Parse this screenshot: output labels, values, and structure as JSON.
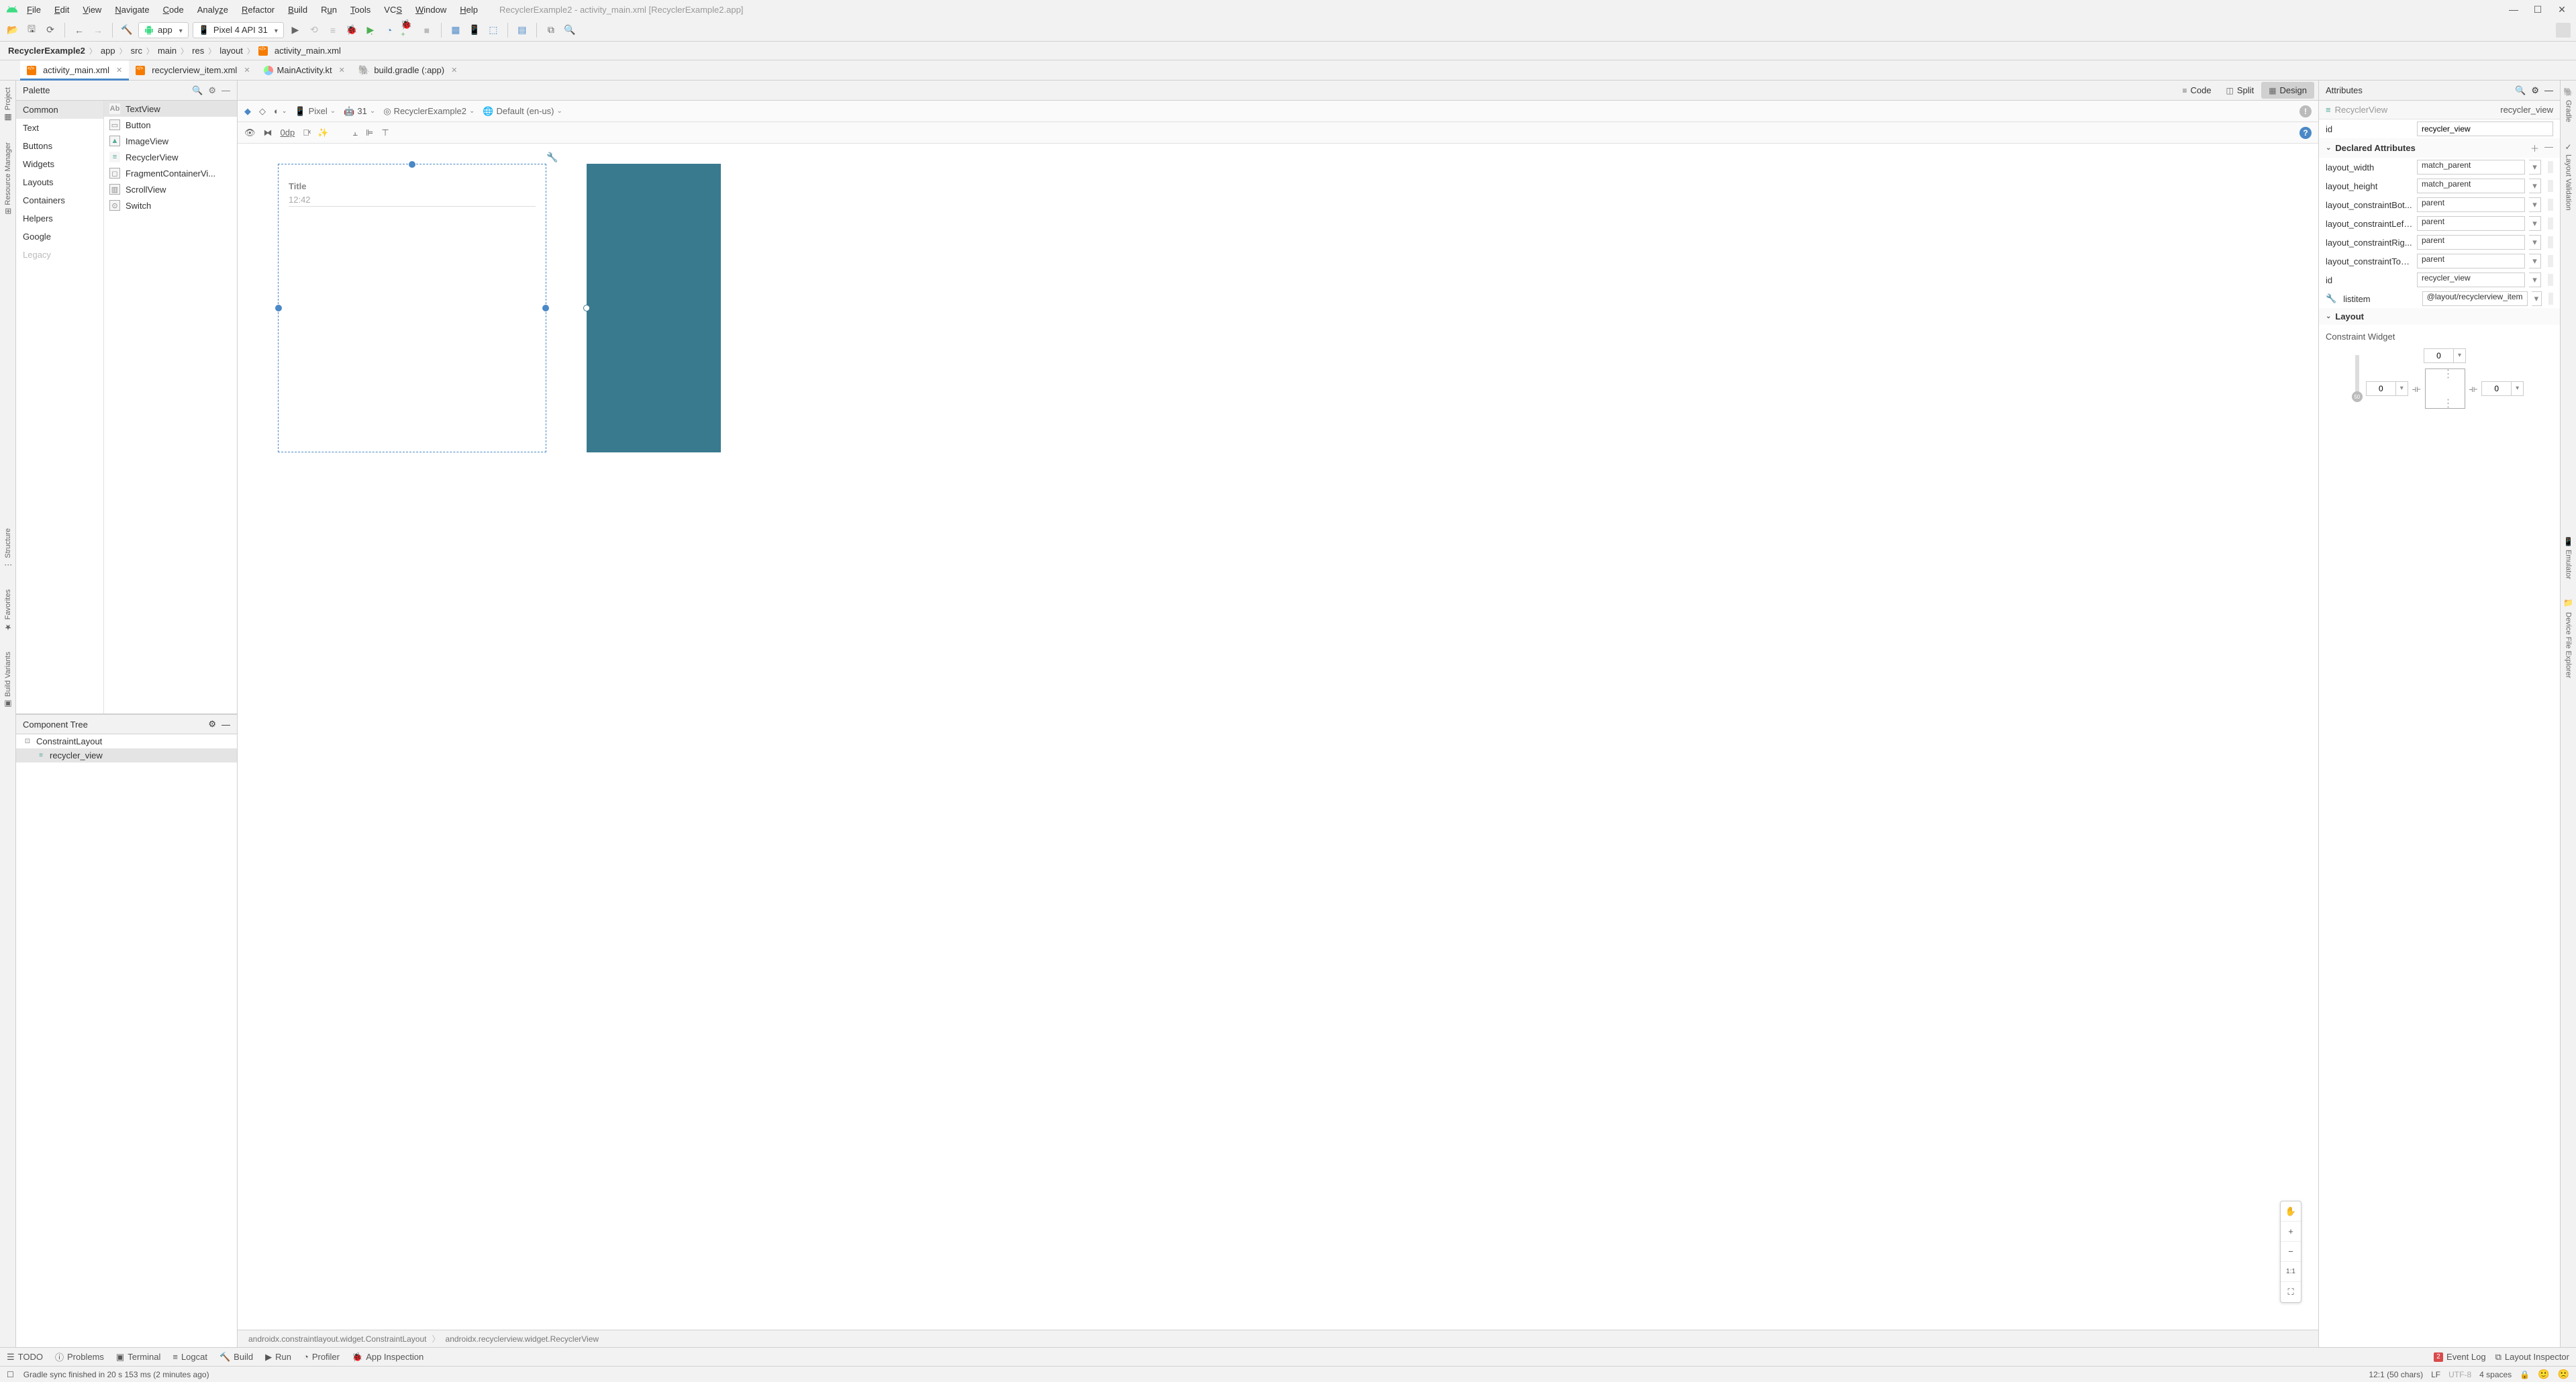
{
  "window": {
    "title_suffix": "RecyclerExample2 - activity_main.xml [RecyclerExample2.app]"
  },
  "menu": [
    "File",
    "Edit",
    "View",
    "Navigate",
    "Code",
    "Analyze",
    "Refactor",
    "Build",
    "Run",
    "Tools",
    "VCS",
    "Window",
    "Help"
  ],
  "toolbar": {
    "run_config": "app",
    "device": "Pixel 4 API 31"
  },
  "breadcrumbs": [
    "RecyclerExample2",
    "app",
    "src",
    "main",
    "res",
    "layout",
    "activity_main.xml"
  ],
  "tabs": [
    {
      "label": "activity_main.xml",
      "icon": "xml",
      "active": true
    },
    {
      "label": "recyclerview_item.xml",
      "icon": "xml",
      "active": false
    },
    {
      "label": "MainActivity.kt",
      "icon": "kt",
      "active": false
    },
    {
      "label": "build.gradle (:app)",
      "icon": "gradle",
      "active": false
    }
  ],
  "view_modes": {
    "code": "Code",
    "split": "Split",
    "design": "Design"
  },
  "left_rail": [
    "Project",
    "Resource Manager",
    "Structure",
    "Favorites",
    "Build Variants"
  ],
  "right_rail": [
    "Gradle",
    "Layout Validation",
    "Emulator",
    "Device File Explorer"
  ],
  "palette": {
    "title": "Palette",
    "categories": [
      "Common",
      "Text",
      "Buttons",
      "Widgets",
      "Layouts",
      "Containers",
      "Helpers",
      "Google",
      "Legacy"
    ],
    "selected_category": "Common",
    "items": [
      "TextView",
      "Button",
      "ImageView",
      "RecyclerView",
      "FragmentContainerVi...",
      "ScrollView",
      "Switch"
    ],
    "selected_item": "TextView"
  },
  "component_tree": {
    "title": "Component Tree",
    "root": "ConstraintLayout",
    "child": "recycler_view"
  },
  "editor_bar1": {
    "pixel": "Pixel",
    "api": "31",
    "app": "RecyclerExample2",
    "locale": "Default (en-us)"
  },
  "editor_bar2": {
    "margin": "0dp"
  },
  "preview": {
    "title": "Title",
    "time": "12:42"
  },
  "canvas_crumbs": [
    "androidx.constraintlayout.widget.ConstraintLayout",
    "androidx.recyclerview.widget.RecyclerView"
  ],
  "attributes": {
    "title": "Attributes",
    "component_type": "RecyclerView",
    "component_name": "recycler_view",
    "id_label": "id",
    "id_value": "recycler_view",
    "declared_title": "Declared Attributes",
    "rows": [
      {
        "label": "layout_width",
        "value": "match_parent"
      },
      {
        "label": "layout_height",
        "value": "match_parent"
      },
      {
        "label": "layout_constraintBot...",
        "value": "parent"
      },
      {
        "label": "layout_constraintLeft...",
        "value": "parent"
      },
      {
        "label": "layout_constraintRig...",
        "value": "parent"
      },
      {
        "label": "layout_constraintTop...",
        "value": "parent"
      },
      {
        "label": "id",
        "value": "recycler_view"
      },
      {
        "label": "listitem",
        "value": "@layout/recyclerview_item",
        "wrench": true
      }
    ],
    "layout_title": "Layout",
    "constraint_title": "Constraint Widget",
    "cw": {
      "top": "0",
      "left": "0",
      "right": "0",
      "slider": "50"
    }
  },
  "zoom": {
    "pan": "✋",
    "plus": "+",
    "minus": "−",
    "fit": "1:1",
    "frame": "⛶"
  },
  "bottom": {
    "todo": "TODO",
    "problems": "Problems",
    "terminal": "Terminal",
    "logcat": "Logcat",
    "build": "Build",
    "run": "Run",
    "profiler": "Profiler",
    "inspection": "App Inspection",
    "event_count": "2",
    "event_log": "Event Log",
    "layout_inspector": "Layout Inspector"
  },
  "status": {
    "msg": "Gradle sync finished in 20 s 153 ms (2 minutes ago)",
    "pos": "12:1 (50 chars)",
    "line_sep": "LF",
    "encoding": "UTF-8",
    "indent": "4 spaces"
  }
}
